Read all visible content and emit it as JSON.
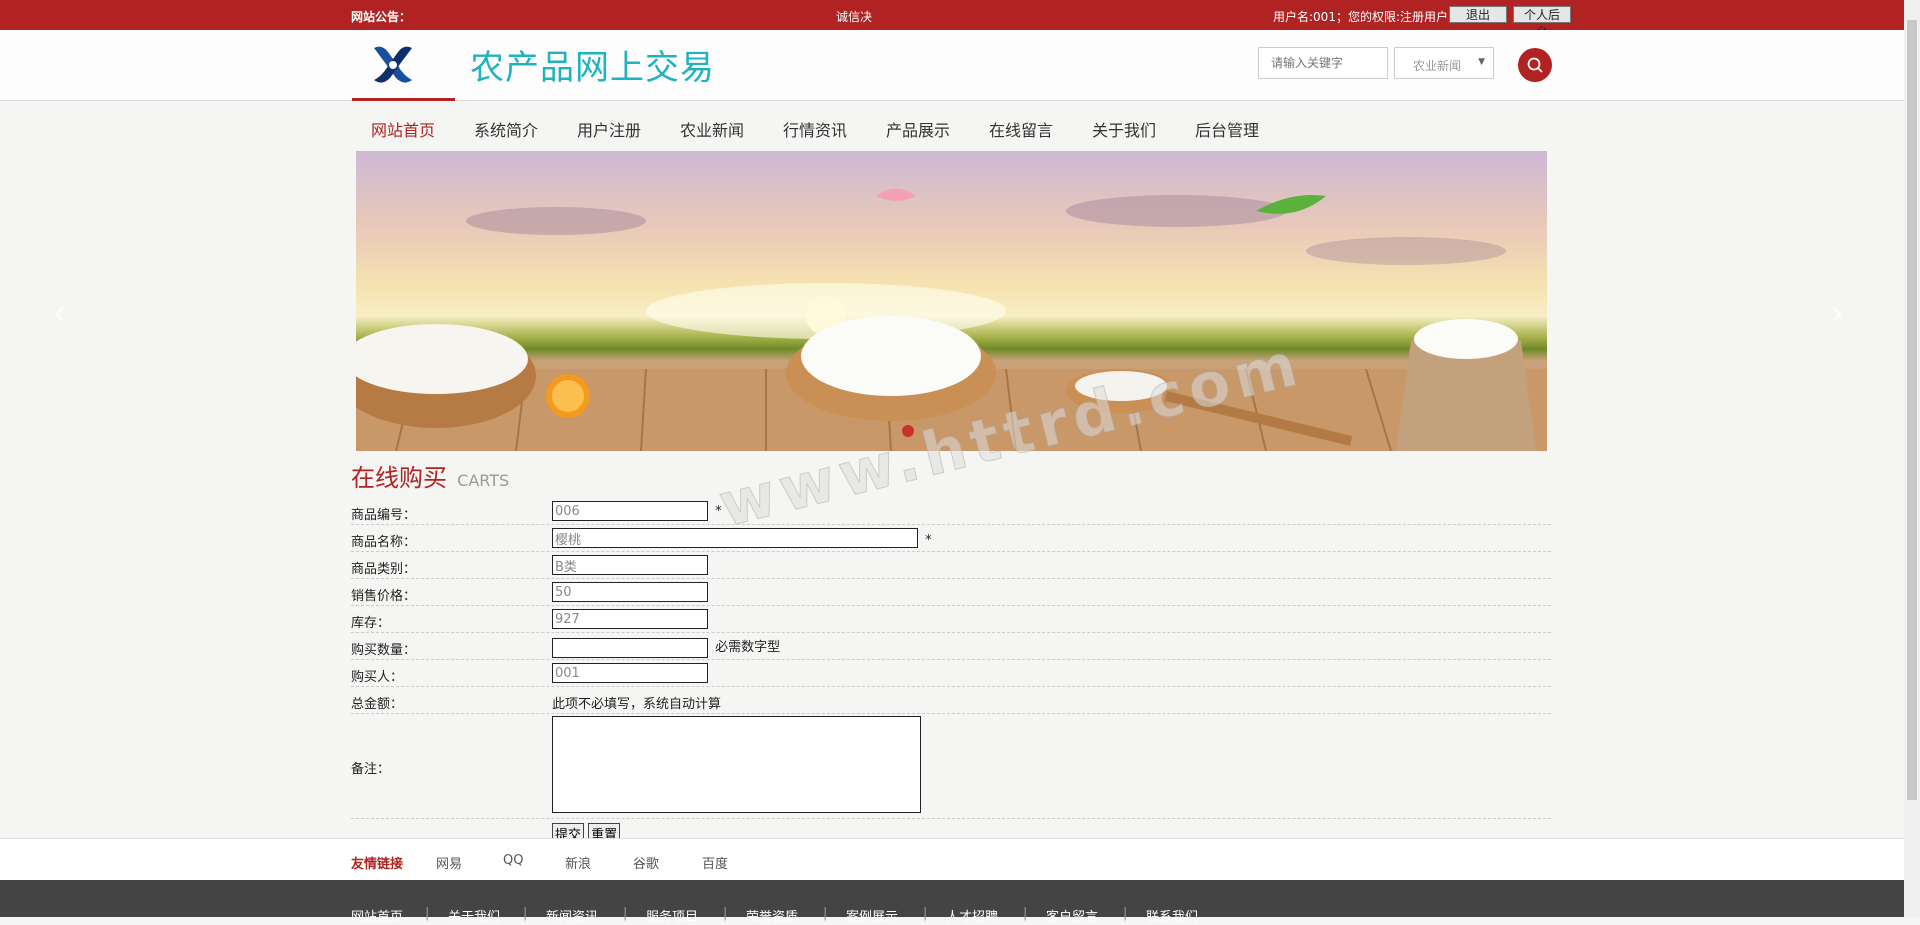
{
  "topbar": {
    "notice_label": "网站公告：",
    "notice_text": "诚信决",
    "user_info": "用户名:001；您的权限:注册用户",
    "logout_label": "退出",
    "backend_label": "个人后台"
  },
  "header": {
    "site_title": "农产品网上交易",
    "search_placeholder": "请输入关键字",
    "search_category": "农业新闻",
    "logo_icon": "logo-icon",
    "search_icon": "search-icon"
  },
  "nav": {
    "items": [
      "网站首页",
      "系统简介",
      "用户注册",
      "农业新闻",
      "行情资讯",
      "产品展示",
      "在线留言",
      "关于我们",
      "后台管理"
    ],
    "active_index": 0
  },
  "banner": {
    "prev_icon": "chevron-left-icon",
    "next_icon": "chevron-right-icon",
    "watermark": "www.httrd.com"
  },
  "section": {
    "title_cn": "在线购买",
    "title_en": "CARTS"
  },
  "form": {
    "product_no_label": "商品编号：",
    "product_no_value": "006",
    "product_no_mark": "*",
    "product_name_label": "商品名称：",
    "product_name_value": "樱桃",
    "product_name_mark": "*",
    "category_label": "商品类别：",
    "category_value": "B类",
    "price_label": "销售价格：",
    "price_value": "50",
    "stock_label": "库存：",
    "stock_value": "927",
    "quantity_label": "购买数量：",
    "quantity_value": "",
    "quantity_note": "必需数字型",
    "buyer_label": "购买人：",
    "buyer_value": "001",
    "total_label": "总金额：",
    "total_note": "此项不必填写，系统自动计算",
    "remark_label": "备注：",
    "submit_label": "提交",
    "reset_label": "重置"
  },
  "links": {
    "label": "友情链接",
    "items": [
      "网易",
      "QQ",
      "新浪",
      "谷歌",
      "百度"
    ]
  },
  "footer": {
    "items": [
      "网站首页",
      "关于我们",
      "新闻资讯",
      "服务项目",
      "荣誉资质",
      "案例展示",
      "人才招聘",
      "客户留言",
      "联系我们"
    ]
  },
  "colors": {
    "brand_red": "#b02322",
    "title_teal": "#1fb3bf",
    "footer_bg": "#444444"
  }
}
